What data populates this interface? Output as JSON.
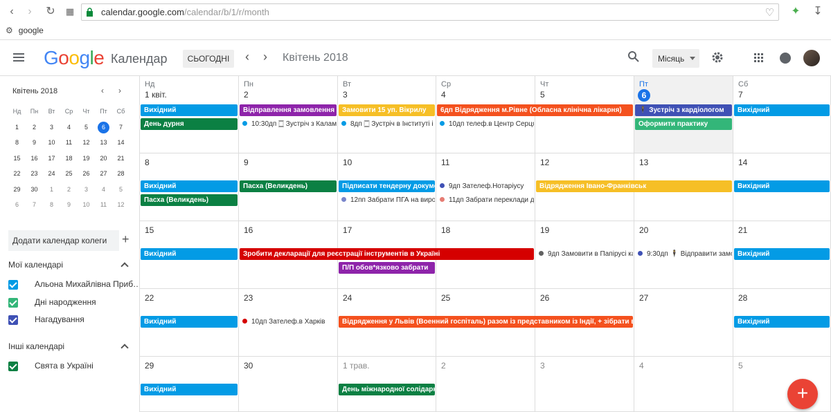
{
  "browser": {
    "url_host": "calendar.google.com",
    "url_path": "/calendar/b/1/r/month",
    "bookmark": "google"
  },
  "app": {
    "logo": [
      "G",
      "o",
      "o",
      "g",
      "l",
      "e"
    ],
    "name": "Календар",
    "today_label": "СЬОГОДНІ",
    "month_title": "Квітень 2018",
    "view_label": "Місяць"
  },
  "mini": {
    "title": "Квітень 2018",
    "weekdays": [
      "Нд",
      "Пн",
      "Вт",
      "Ср",
      "Чт",
      "Пт",
      "Сб"
    ],
    "weeks": [
      [
        "1",
        "2",
        "3",
        "4",
        "5",
        "6",
        "7"
      ],
      [
        "8",
        "9",
        "10",
        "11",
        "12",
        "13",
        "14"
      ],
      [
        "15",
        "16",
        "17",
        "18",
        "19",
        "20",
        "21"
      ],
      [
        "22",
        "23",
        "24",
        "25",
        "26",
        "27",
        "28"
      ],
      [
        "29",
        "30",
        "1",
        "2",
        "3",
        "4",
        "5"
      ],
      [
        "6",
        "7",
        "8",
        "9",
        "10",
        "11",
        "12"
      ]
    ],
    "selected": "6"
  },
  "sidebar": {
    "add_colleague": "Додати календар колеги",
    "my_calendars": "Мої календарі",
    "other_calendars": "Інші календарі",
    "my": [
      {
        "label": "Альона Михайлівна Приб…",
        "color": "#039be5"
      },
      {
        "label": "Дні народження",
        "color": "#33b679"
      },
      {
        "label": "Нагадування",
        "color": "#3f51b5"
      }
    ],
    "other": [
      {
        "label": "Свята в Україні",
        "color": "#0b8043"
      }
    ]
  },
  "grid": {
    "weekdays": [
      "Нд",
      "Пн",
      "Вт",
      "Ср",
      "Чт",
      "Пт",
      "Сб"
    ],
    "today_index": 5,
    "weeks": [
      [
        "1 квіт.",
        "2",
        "3",
        "4",
        "5",
        "6",
        "7"
      ],
      [
        "8",
        "9",
        "10",
        "11",
        "12",
        "13",
        "14"
      ],
      [
        "15",
        "16",
        "17",
        "18",
        "19",
        "20",
        "21"
      ],
      [
        "22",
        "23",
        "24",
        "25",
        "26",
        "27",
        "28"
      ],
      [
        "29",
        "30",
        "1 трав.",
        "2",
        "3",
        "4",
        "5"
      ]
    ],
    "dim": [
      [
        4,
        2
      ],
      [
        4,
        3
      ],
      [
        4,
        4
      ],
      [
        4,
        5
      ],
      [
        4,
        6
      ]
    ],
    "events": [
      {
        "w": 0,
        "d": 0,
        "span": 1,
        "row": 0,
        "text": "Вихідний",
        "color": "#039be5"
      },
      {
        "w": 0,
        "d": 0,
        "span": 1,
        "row": 1,
        "text": "День дурня",
        "color": "#0b8043"
      },
      {
        "w": 0,
        "d": 1,
        "span": 1,
        "row": 0,
        "text": "Відправлення замовлення",
        "color": "#8e24aa"
      },
      {
        "w": 0,
        "d": 2,
        "span": 1,
        "row": 0,
        "text": "Замовити 15 уп. Вікрилу",
        "color": "#f6bf26"
      },
      {
        "w": 0,
        "d": 3,
        "span": 2,
        "row": 0,
        "text": "6дп Відрядження м.Рівне (Обласна клінічна лікарня)",
        "color": "#f4511e"
      },
      {
        "w": 0,
        "d": 5,
        "span": 1,
        "row": 0,
        "text": "🕴 Зустріч з кардіологом",
        "color": "#3f51b5"
      },
      {
        "w": 0,
        "d": 5,
        "span": 1,
        "row": 1,
        "text": "Оформити практику",
        "color": "#33b679"
      },
      {
        "w": 0,
        "d": 6,
        "span": 1,
        "row": 0,
        "text": "Вихідний",
        "color": "#039be5"
      },
      {
        "w": 1,
        "d": 0,
        "span": 1,
        "row": 0,
        "text": "Вихідний",
        "color": "#039be5"
      },
      {
        "w": 1,
        "d": 0,
        "span": 1,
        "row": 1,
        "text": "Пасха (Великдень)",
        "color": "#0b8043"
      },
      {
        "w": 1,
        "d": 1,
        "span": 1,
        "row": 0,
        "text": "Пасха (Великдень)",
        "color": "#0b8043"
      },
      {
        "w": 1,
        "d": 2,
        "span": 1,
        "row": 0,
        "text": "Підписати тендерну докуме",
        "color": "#039be5"
      },
      {
        "w": 1,
        "d": 4,
        "span": 2,
        "row": 0,
        "text": "Відрядження Івано-Франківськ",
        "color": "#f6bf26"
      },
      {
        "w": 1,
        "d": 6,
        "span": 1,
        "row": 0,
        "text": "Вихідний",
        "color": "#039be5"
      },
      {
        "w": 2,
        "d": 0,
        "span": 1,
        "row": 0,
        "text": "Вихідний",
        "color": "#039be5"
      },
      {
        "w": 2,
        "d": 1,
        "span": 3,
        "row": 0,
        "text": "Зробити декларації для реєстрації інструментів в Україні",
        "color": "#d50000"
      },
      {
        "w": 2,
        "d": 2,
        "span": 1,
        "row": 1,
        "text": "П/П обов*язково забрати",
        "color": "#8e24aa"
      },
      {
        "w": 2,
        "d": 6,
        "span": 1,
        "row": 0,
        "text": "Вихідний",
        "color": "#039be5"
      },
      {
        "w": 3,
        "d": 0,
        "span": 1,
        "row": 0,
        "text": "Вихідний",
        "color": "#039be5"
      },
      {
        "w": 3,
        "d": 2,
        "span": 3,
        "row": 0,
        "text": "Відрядження у Львів (Военний госпіталь) разом із представником із Індії, + зібрати всі необ",
        "color": "#f4511e"
      },
      {
        "w": 3,
        "d": 6,
        "span": 1,
        "row": 0,
        "text": "Вихідний",
        "color": "#039be5"
      },
      {
        "w": 4,
        "d": 0,
        "span": 1,
        "row": 0,
        "text": "Вихідний",
        "color": "#039be5"
      },
      {
        "w": 4,
        "d": 2,
        "span": 1,
        "row": 0,
        "text": "День міжнародної солідарн",
        "color": "#0b8043"
      }
    ],
    "timed": [
      {
        "w": 0,
        "d": 1,
        "row": 1,
        "text": "10:30дп 🀆 Зустріч з Калам",
        "color": "#039be5"
      },
      {
        "w": 0,
        "d": 2,
        "row": 1,
        "text": "8дп 🀆 Зустріч в Інституті і",
        "color": "#039be5"
      },
      {
        "w": 0,
        "d": 3,
        "row": 1,
        "text": "10дп телеф.в Центр Серця",
        "color": "#039be5"
      },
      {
        "w": 1,
        "d": 3,
        "row": 0,
        "text": "9дп Зателеф.Нотаріусу",
        "color": "#3f51b5"
      },
      {
        "w": 1,
        "d": 3,
        "row": 1,
        "text": "11дп Забрати переклади д",
        "color": "#e67c73"
      },
      {
        "w": 1,
        "d": 2,
        "row": 1,
        "text": "12пп Забрати ПГА на вироб",
        "color": "#7986cb"
      },
      {
        "w": 2,
        "d": 4,
        "row": 0,
        "text": "9дп Замовити в Папірусі ка",
        "color": "#616161"
      },
      {
        "w": 2,
        "d": 5,
        "row": 0,
        "text": "9:30дп 🕴 Відправити замо",
        "color": "#3f51b5"
      },
      {
        "w": 3,
        "d": 1,
        "row": 0,
        "text": "10дп Зателеф.в Харків",
        "color": "#d50000"
      }
    ]
  },
  "fab": "+"
}
